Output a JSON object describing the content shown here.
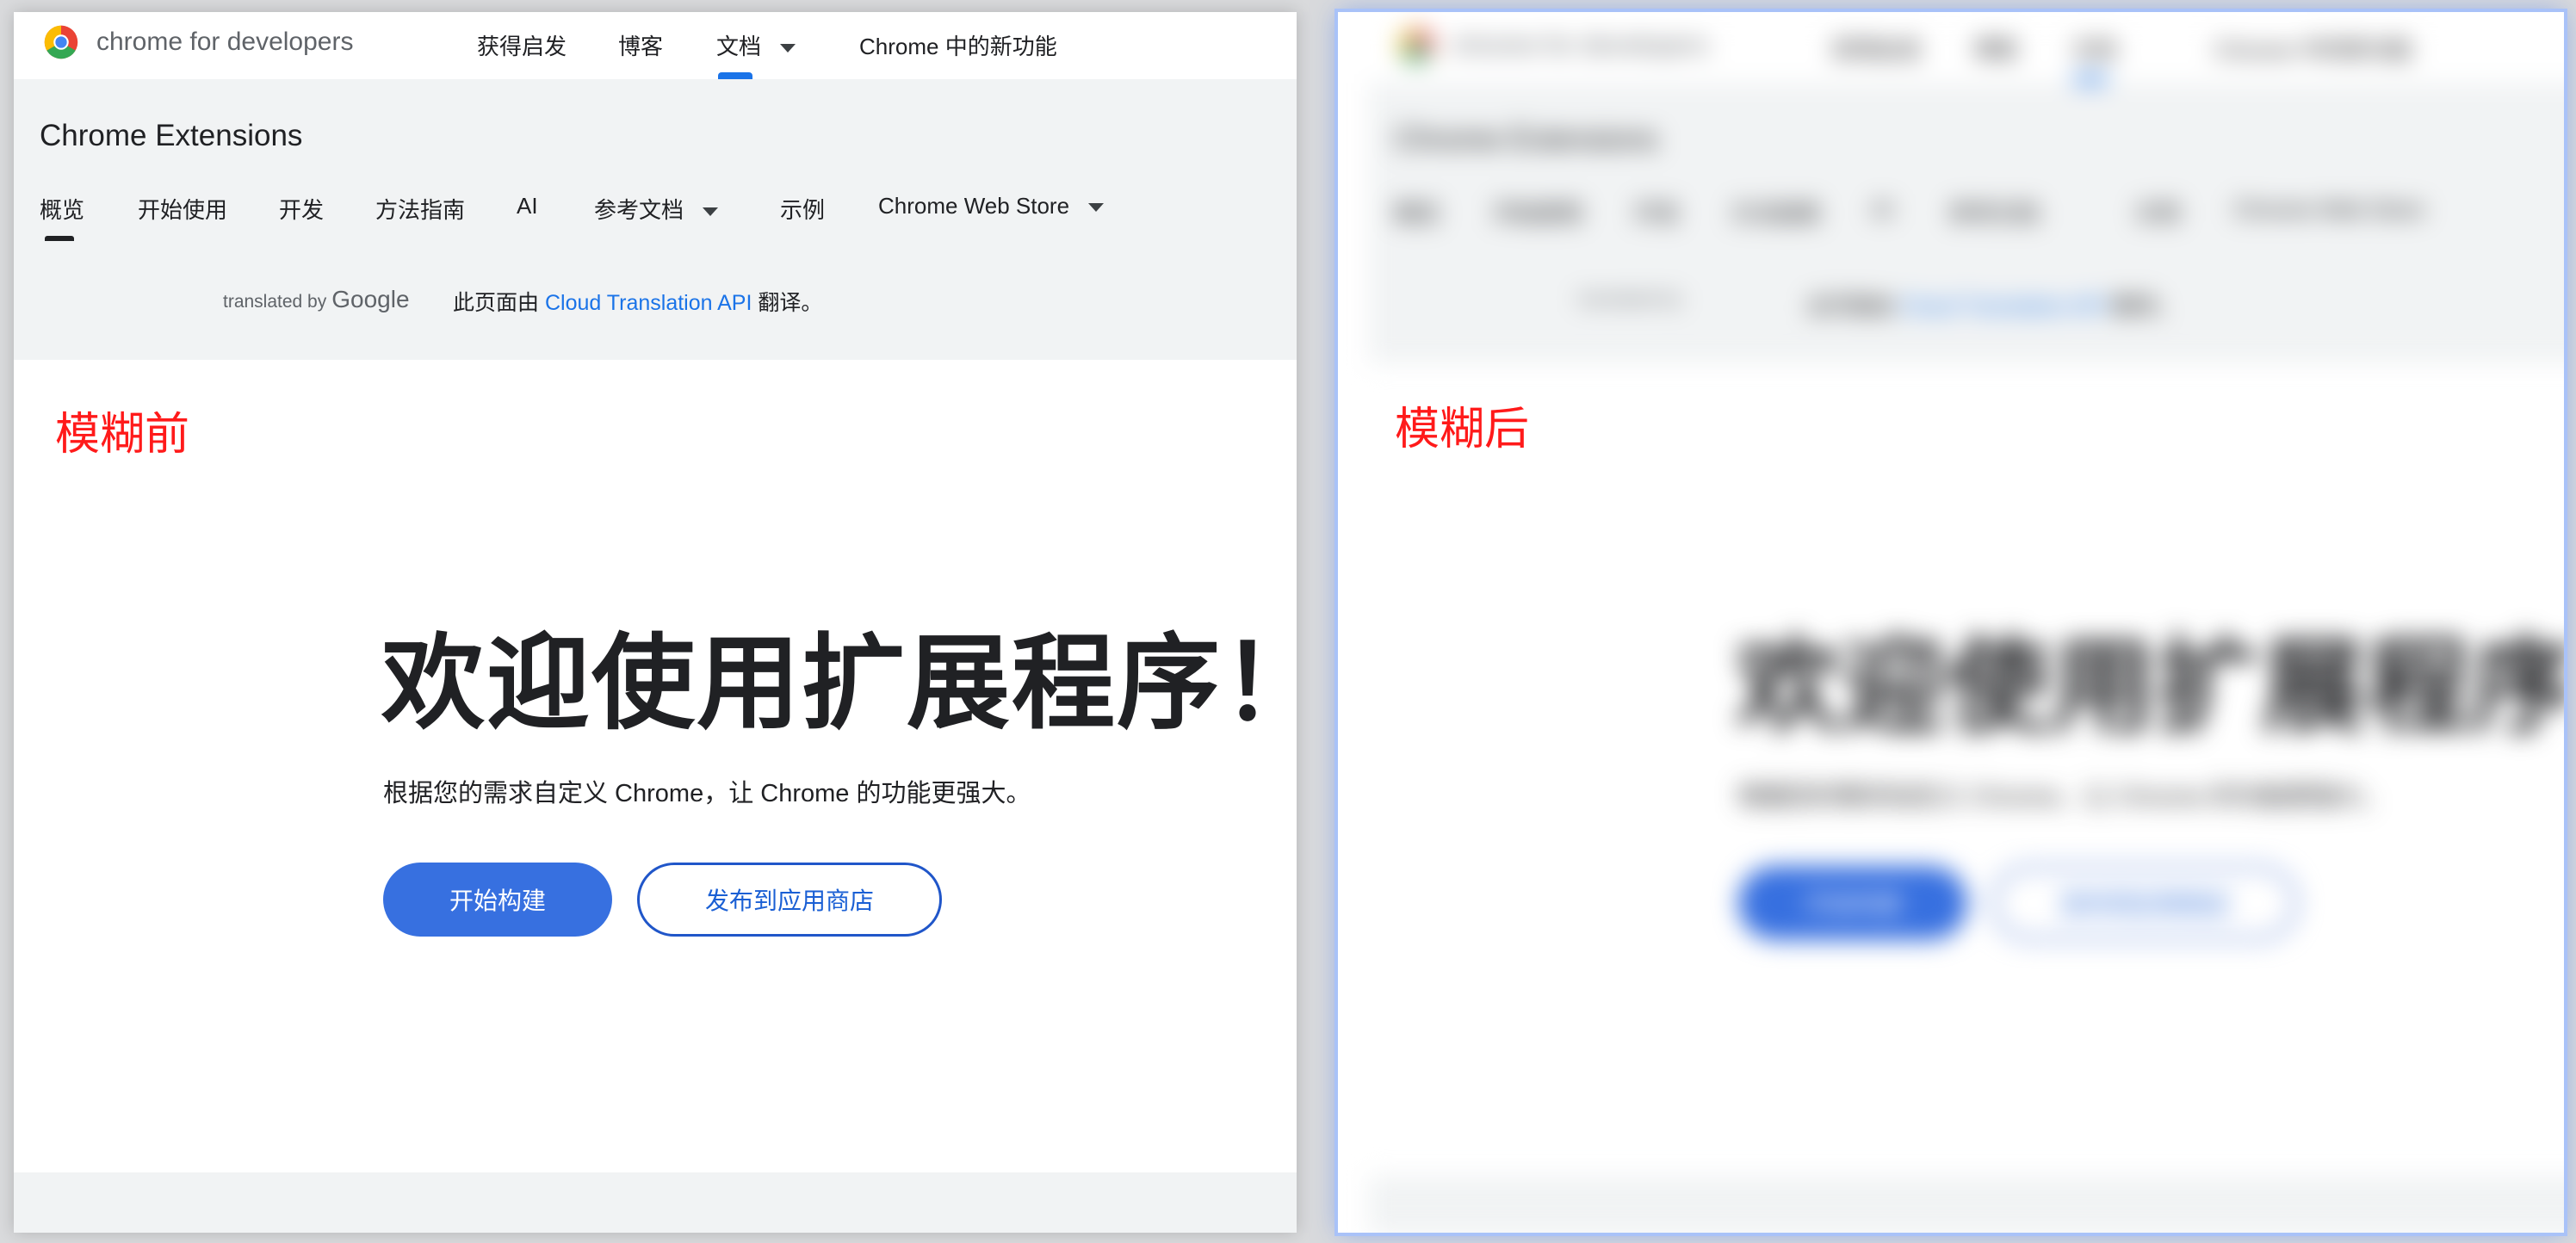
{
  "topnav": {
    "brand": "chrome for developers",
    "items": [
      "获得启发",
      "博客",
      "文档",
      "Chrome 中的新功能"
    ]
  },
  "section": {
    "title": "Chrome Extensions",
    "tabs": [
      "概览",
      "开始使用",
      "开发",
      "方法指南",
      "AI",
      "参考文档",
      "示例",
      "Chrome Web Store"
    ]
  },
  "translation": {
    "translated_by": "translated by",
    "google": "Google",
    "note_prefix": "此页面由",
    "api_link": "Cloud Translation API",
    "note_suffix": "翻译。"
  },
  "annotations": {
    "before": "模糊前",
    "after": "模糊后"
  },
  "hero": {
    "title": "欢迎使用扩展程序！",
    "subtitle": "根据您的需求自定义 Chrome，让 Chrome 的功能更强大。",
    "primary_button": "开始构建",
    "secondary_button": "发布到应用商店"
  },
  "colors": {
    "annotation": "#ff1a1a",
    "accent": "#1a73e8",
    "primary_button": "#3770e0",
    "after_panel_glow": "#a9c2f8"
  }
}
